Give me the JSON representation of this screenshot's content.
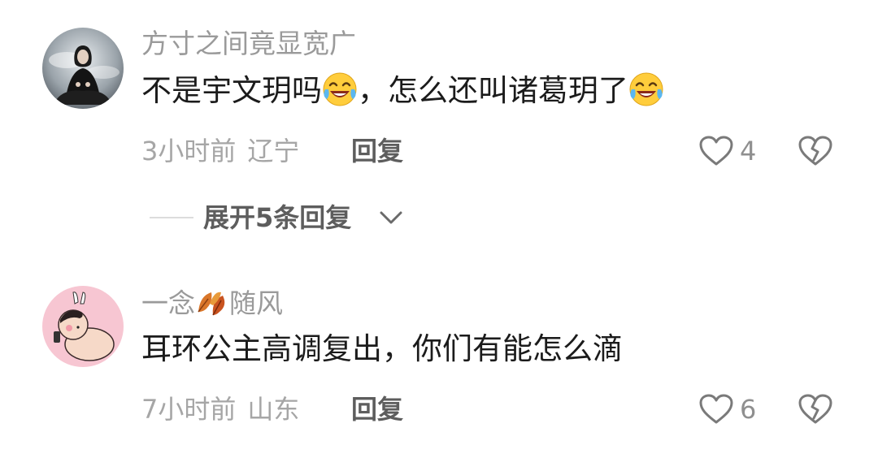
{
  "comments": [
    {
      "username": "方寸之间竟显宽广",
      "content_part1": "不是宇文玥吗",
      "content_part2": "，怎么还叫诸葛玥了",
      "time": "3小时前",
      "location": "辽宁",
      "reply_label": "回复",
      "likes": "4",
      "emoji": "crying-laughing-emoji-icon"
    },
    {
      "username_part1": "一念",
      "username_part2": "随风",
      "content": "耳环公主高调复出，你们有能怎么滴",
      "time": "7小时前",
      "location": "山东",
      "reply_label": "回复",
      "likes": "6",
      "username_icon": "autumn-leaf-icon"
    }
  ],
  "expand_replies": {
    "label": "展开5条回复"
  },
  "colors": {
    "username": "#9a9a9a",
    "content": "#1b1b1b",
    "meta": "#a6a6a6",
    "reply": "#5d5d5d"
  }
}
